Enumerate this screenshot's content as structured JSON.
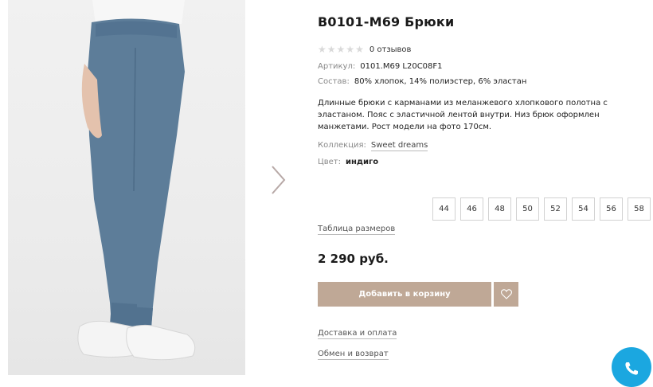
{
  "product": {
    "title": "B0101-M69 Брюки",
    "rating_stars": 0,
    "reviews": "0 отзывов",
    "sku_label": "Артикул:",
    "sku_value": "0101.M69 L20C08F1",
    "composition_label": "Состав:",
    "composition_value": "80% хлопок, 14% полиэстер, 6% эластан",
    "description": "Длинные брюки с карманами из меланжевого хлопкового полотна с эластаном. Пояс с эластичной лентой внутри. Низ брюк оформлен манжетами. Рост модели на фото 170см.",
    "collection_label": "Коллекция:",
    "collection_value": "Sweet dreams",
    "color_label": "Цвет:",
    "color_value": "индиго",
    "sizes": [
      "44",
      "46",
      "48",
      "50",
      "52",
      "54",
      "56",
      "58"
    ],
    "size_table": "Таблица размеров",
    "price": "2 290 руб."
  },
  "actions": {
    "add_to_cart": "Добавить в корзину",
    "wishlist_icon": "heart-icon",
    "delivery": "Доставка и оплата",
    "returns": "Обмен и возврат",
    "call_icon": "phone-icon"
  },
  "colors": {
    "accent": "#bfa896",
    "call_button": "#1ba7e0",
    "pants": "#5d7d99"
  }
}
